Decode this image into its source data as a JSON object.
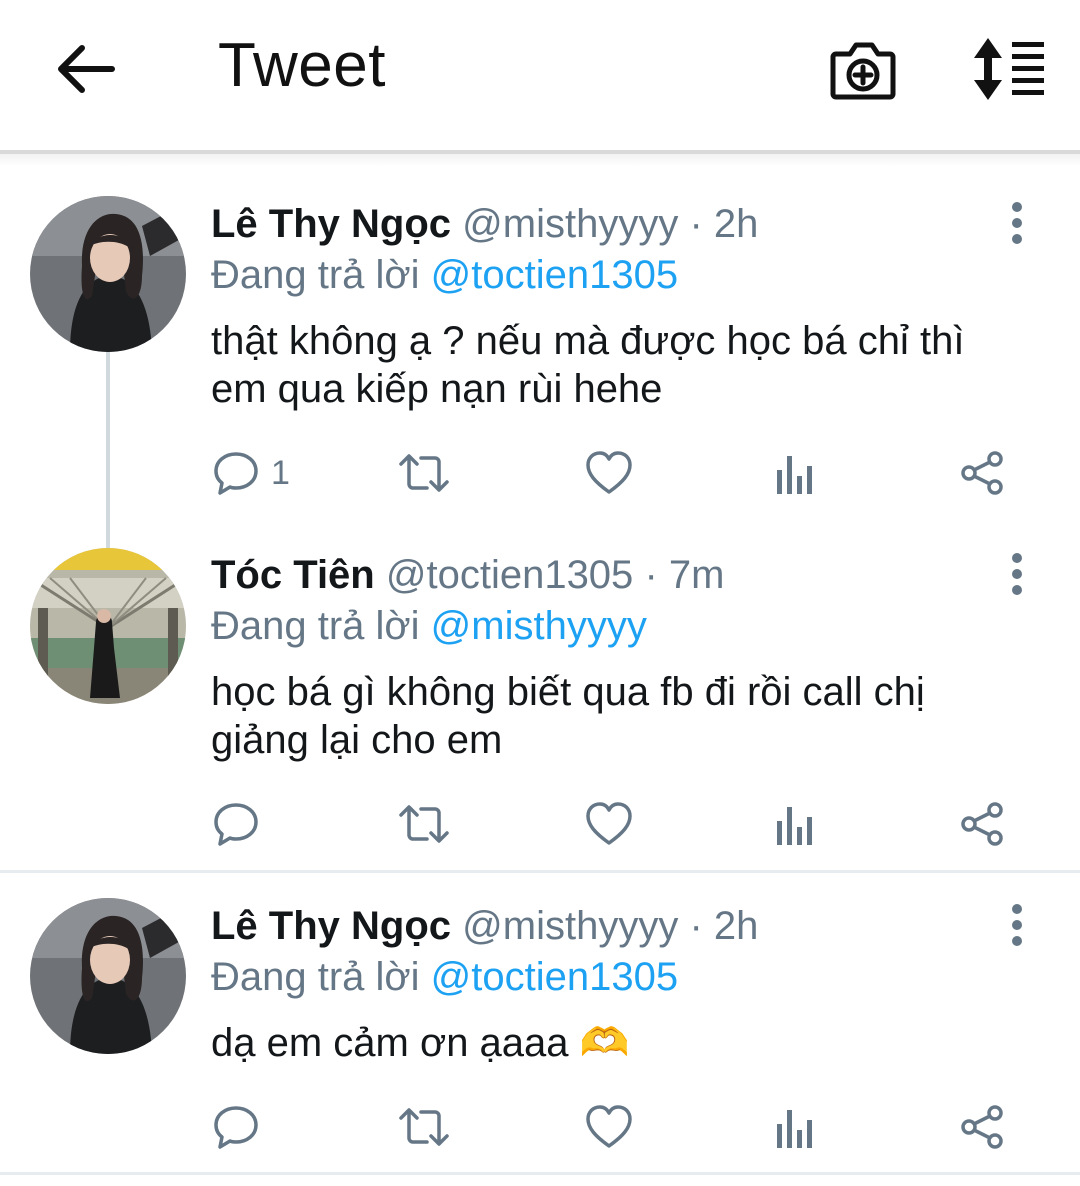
{
  "header": {
    "title": "Tweet",
    "icons": [
      "back-arrow-icon",
      "camera-icon",
      "sort-icon"
    ]
  },
  "tweets": [
    {
      "name": "Lê Thy Ngọc",
      "handle": "@misthyyyy",
      "dot": "·",
      "time": "2h",
      "reply_prefix": "Đang trả lời",
      "reply_handle": "@toctien1305",
      "text": "thật không ạ ? nếu mà được học bá chỉ thì em qua kiếp nạn rùi hehe",
      "reply_count": "1"
    },
    {
      "name": "Tóc Tiên",
      "handle": "@toctien1305",
      "dot": "·",
      "time": "7m",
      "reply_prefix": "Đang trả lời",
      "reply_handle": "@misthyyyy",
      "text": "học bá gì không biết qua fb đi rồi call chị giảng lại cho em",
      "reply_count": ""
    },
    {
      "name": "Lê Thy Ngọc",
      "handle": "@misthyyyy",
      "dot": "·",
      "time": "2h",
      "reply_prefix": "Đang trả lời",
      "reply_handle": "@toctien1305",
      "text": "dạ em cảm ơn ạaaa 🫶",
      "reply_count": ""
    }
  ],
  "colors": {
    "accent": "#1da1f2",
    "muted": "#657786",
    "text": "#14171a"
  }
}
